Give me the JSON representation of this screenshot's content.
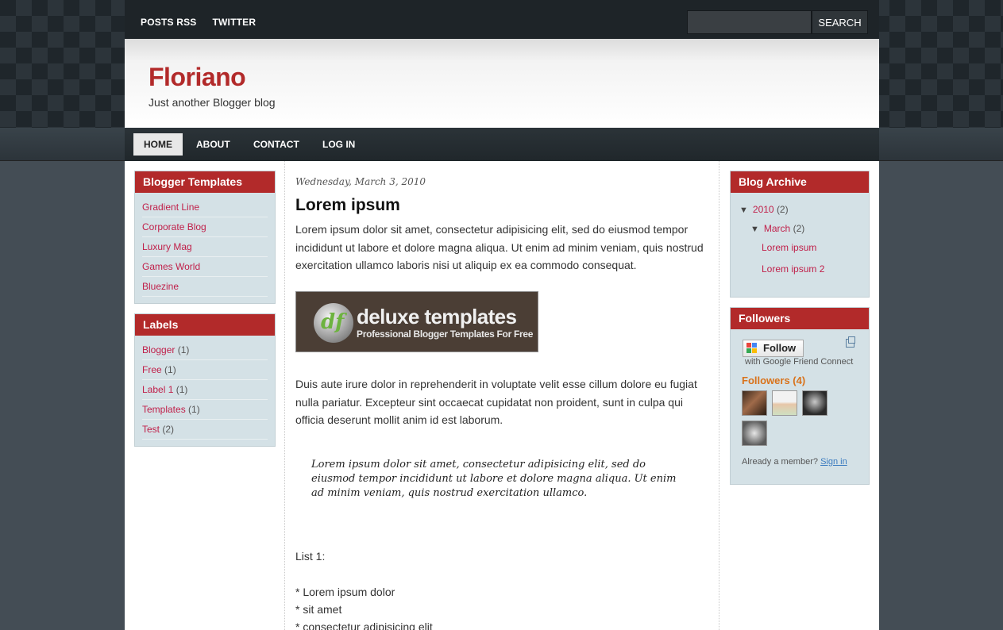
{
  "topbar": {
    "links": [
      "POSTS RSS",
      "TWITTER"
    ],
    "search_placeholder": "",
    "search_button": "SEARCH"
  },
  "header": {
    "title": "Floriano",
    "description": "Just another Blogger blog"
  },
  "nav": {
    "items": [
      "HOME",
      "ABOUT",
      "CONTACT",
      "LOG IN"
    ],
    "active": "HOME"
  },
  "sidebar_left": {
    "templates": {
      "title": "Blogger Templates",
      "items": [
        "Gradient Line",
        "Corporate Blog",
        "Luxury Mag",
        "Games World",
        "Bluezine"
      ]
    },
    "labels": {
      "title": "Labels",
      "items": [
        {
          "name": "Blogger",
          "count": "(1)"
        },
        {
          "name": "Free",
          "count": "(1)"
        },
        {
          "name": "Label 1",
          "count": "(1)"
        },
        {
          "name": "Templates",
          "count": "(1)"
        },
        {
          "name": "Test",
          "count": "(2)"
        }
      ]
    }
  },
  "post": {
    "date": "Wednesday, March 3, 2010",
    "title": "Lorem ipsum",
    "para1": "Lorem ipsum dolor sit amet, consectetur adipisicing elit, sed do eiusmod tempor incididunt ut labore et dolore magna aliqua. Ut enim ad minim veniam, quis nostrud exercitation ullamco laboris nisi ut aliquip ex ea commodo consequat.",
    "banner_main": "deluxe templates",
    "banner_sub": "Professional Blogger Templates For Free",
    "banner_logo": "df",
    "para2": "Duis aute irure dolor in reprehenderit in voluptate velit esse cillum dolore eu fugiat nulla pariatur. Excepteur sint occaecat cupidatat non proident, sunt in culpa qui officia deserunt mollit anim id est laborum.",
    "quote": "Lorem ipsum dolor sit amet, consectetur adipisicing elit, sed do eiusmod tempor incididunt ut labore et dolore magna aliqua. Ut enim ad minim veniam, quis nostrud exercitation ullamco.",
    "list_title": "List 1:",
    "list_items": [
      "* Lorem ipsum dolor",
      "* sit amet",
      "* consectetur adipisicing elit"
    ]
  },
  "sidebar_right": {
    "archive": {
      "title": "Blog Archive",
      "year": "2010",
      "year_count": "(2)",
      "month": "March",
      "month_count": "(2)",
      "posts": [
        "Lorem ipsum",
        "Lorem ipsum 2"
      ]
    },
    "followers": {
      "title": "Followers",
      "follow_button": "Follow",
      "gfc_text": "with Google Friend Connect",
      "count_label": "Followers (4)",
      "member_text": "Already a member?",
      "sign_in": "Sign in"
    }
  },
  "colors": {
    "accent": "#b22a2a",
    "link": "#c0204a",
    "widget_bg": "#d4e1e6"
  }
}
